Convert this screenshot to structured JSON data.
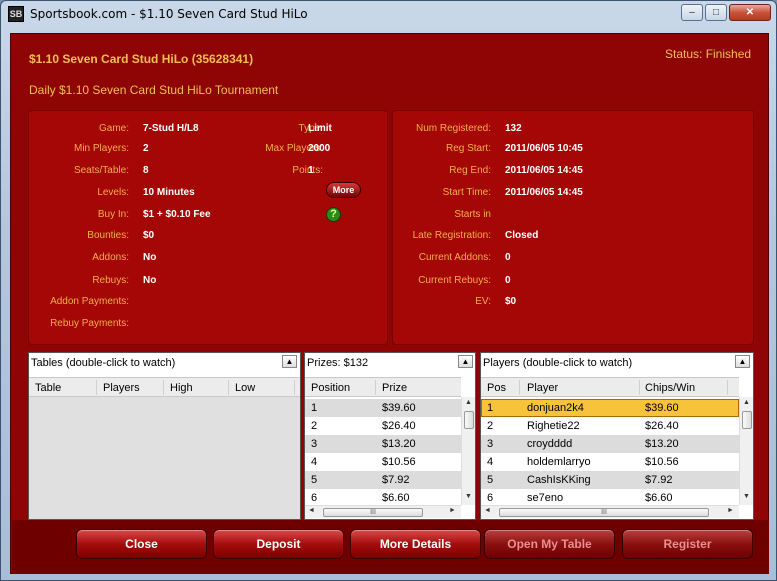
{
  "window": {
    "title": "Sportsbook.com - $1.10 Seven Card Stud HiLo",
    "icon_letters": "SB",
    "min_glyph": "–",
    "max_glyph": "□",
    "close_glyph": "✕"
  },
  "header": {
    "title": "$1.10 Seven Card Stud HiLo (35628341)",
    "subtitle": "Daily $1.10 Seven Card Stud HiLo Tournament",
    "status": "Status: Finished"
  },
  "info_left": {
    "game_label": "Game:",
    "game": "7-Stud H/L8",
    "type_label": "Type:",
    "type": "Limit",
    "min_players_label": "Min Players:",
    "min_players": "2",
    "max_players_label": "Max Players:",
    "max_players": "2000",
    "seats_label": "Seats/Table:",
    "seats": "8",
    "points_label": "Points:",
    "points": "1",
    "levels_label": "Levels:",
    "levels": "10 Minutes",
    "more_button": "More",
    "buyin_label": "Buy In:",
    "buyin": "$1 + $0.10 Fee",
    "help_glyph": "?",
    "bounties_label": "Bounties:",
    "bounties": "$0",
    "addons_label": "Addons:",
    "addons": "No",
    "rebuys_label": "Rebuys:",
    "rebuys": "No",
    "addon_payments_label": "Addon Payments:",
    "rebuy_payments_label": "Rebuy Payments:"
  },
  "info_right": {
    "num_registered_label": "Num Registered:",
    "num_registered": "132",
    "reg_start_label": "Reg Start:",
    "reg_start": "2011/06/05 10:45",
    "reg_end_label": "Reg End:",
    "reg_end": "2011/06/05 14:45",
    "start_time_label": "Start Time:",
    "start_time": "2011/06/05 14:45",
    "starts_in_label": "Starts in",
    "late_reg_label": "Late Registration:",
    "late_reg": "Closed",
    "current_addons_label": "Current Addons:",
    "current_addons": "0",
    "current_rebuys_label": "Current Rebuys:",
    "current_rebuys": "0",
    "ev_label": "EV:",
    "ev": "$0"
  },
  "tables": {
    "title": "Tables (double-click to watch)",
    "columns": [
      "Table",
      "Players",
      "High",
      "Low"
    ]
  },
  "prizes": {
    "title": "Prizes: $132",
    "columns": [
      "Position",
      "Prize"
    ],
    "rows": [
      [
        "1",
        "$39.60"
      ],
      [
        "2",
        "$26.40"
      ],
      [
        "3",
        "$13.20"
      ],
      [
        "4",
        "$10.56"
      ],
      [
        "5",
        "$7.92"
      ],
      [
        "6",
        "$6.60"
      ]
    ]
  },
  "players": {
    "title": "Players (double-click to watch)",
    "columns": [
      "Pos",
      "Player",
      "Chips/Win"
    ],
    "rows": [
      [
        "1",
        "donjuan2k4",
        "$39.60"
      ],
      [
        "2",
        "Righetie22",
        "$26.40"
      ],
      [
        "3",
        "croydddd",
        "$13.20"
      ],
      [
        "4",
        "holdemlarryo",
        "$10.56"
      ],
      [
        "5",
        "CashIsKKing",
        "$7.92"
      ],
      [
        "6",
        "se7eno",
        "$6.60"
      ]
    ]
  },
  "scroll": {
    "up": "▲",
    "down": "▼",
    "left": "◄",
    "right": "►",
    "grip": "III",
    "collapse": "▲"
  },
  "buttons": {
    "close": "Close",
    "deposit": "Deposit",
    "more_details": "More Details",
    "open_my_table": "Open My Table",
    "register": "Register"
  }
}
